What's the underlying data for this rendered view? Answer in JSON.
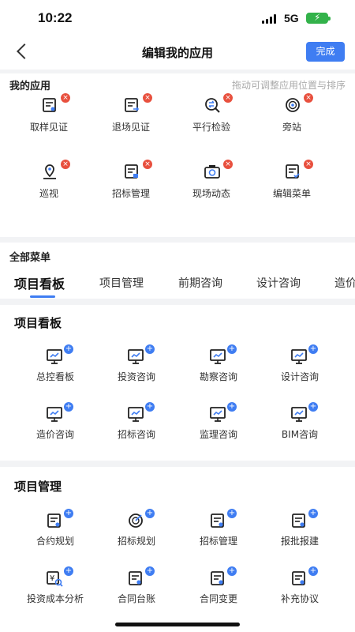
{
  "status": {
    "time": "10:22",
    "network": "5G"
  },
  "nav": {
    "title": "编辑我的应用",
    "done_label": "完成"
  },
  "my_apps": {
    "title": "我的应用",
    "hint": "拖动可调整应用位置与排序",
    "items": [
      {
        "label": "取样见证",
        "icon": "sample-witness-icon"
      },
      {
        "label": "退场见证",
        "icon": "exit-witness-icon"
      },
      {
        "label": "平行检验",
        "icon": "parallel-inspection-icon"
      },
      {
        "label": "旁站",
        "icon": "supervision-icon"
      },
      {
        "label": "巡视",
        "icon": "patrol-icon"
      },
      {
        "label": "招标管理",
        "icon": "bidding-management-icon"
      },
      {
        "label": "现场动态",
        "icon": "site-camera-icon"
      },
      {
        "label": "编辑菜单",
        "icon": "edit-menu-icon"
      }
    ]
  },
  "all_menu": {
    "title": "全部菜单",
    "tabs": [
      "项目看板",
      "项目管理",
      "前期咨询",
      "设计咨询",
      "造价"
    ]
  },
  "board_section": {
    "title": "项目看板",
    "items": [
      "总控看板",
      "投资咨询",
      "勘察咨询",
      "设计咨询",
      "造价咨询",
      "招标咨询",
      "监理咨询",
      "BIM咨询"
    ]
  },
  "manage_section": {
    "title": "项目管理",
    "items": [
      "合约规划",
      "招标规划",
      "招标管理",
      "报批报建",
      "投资成本分析",
      "合同台账",
      "合同变更",
      "补充协议"
    ]
  }
}
